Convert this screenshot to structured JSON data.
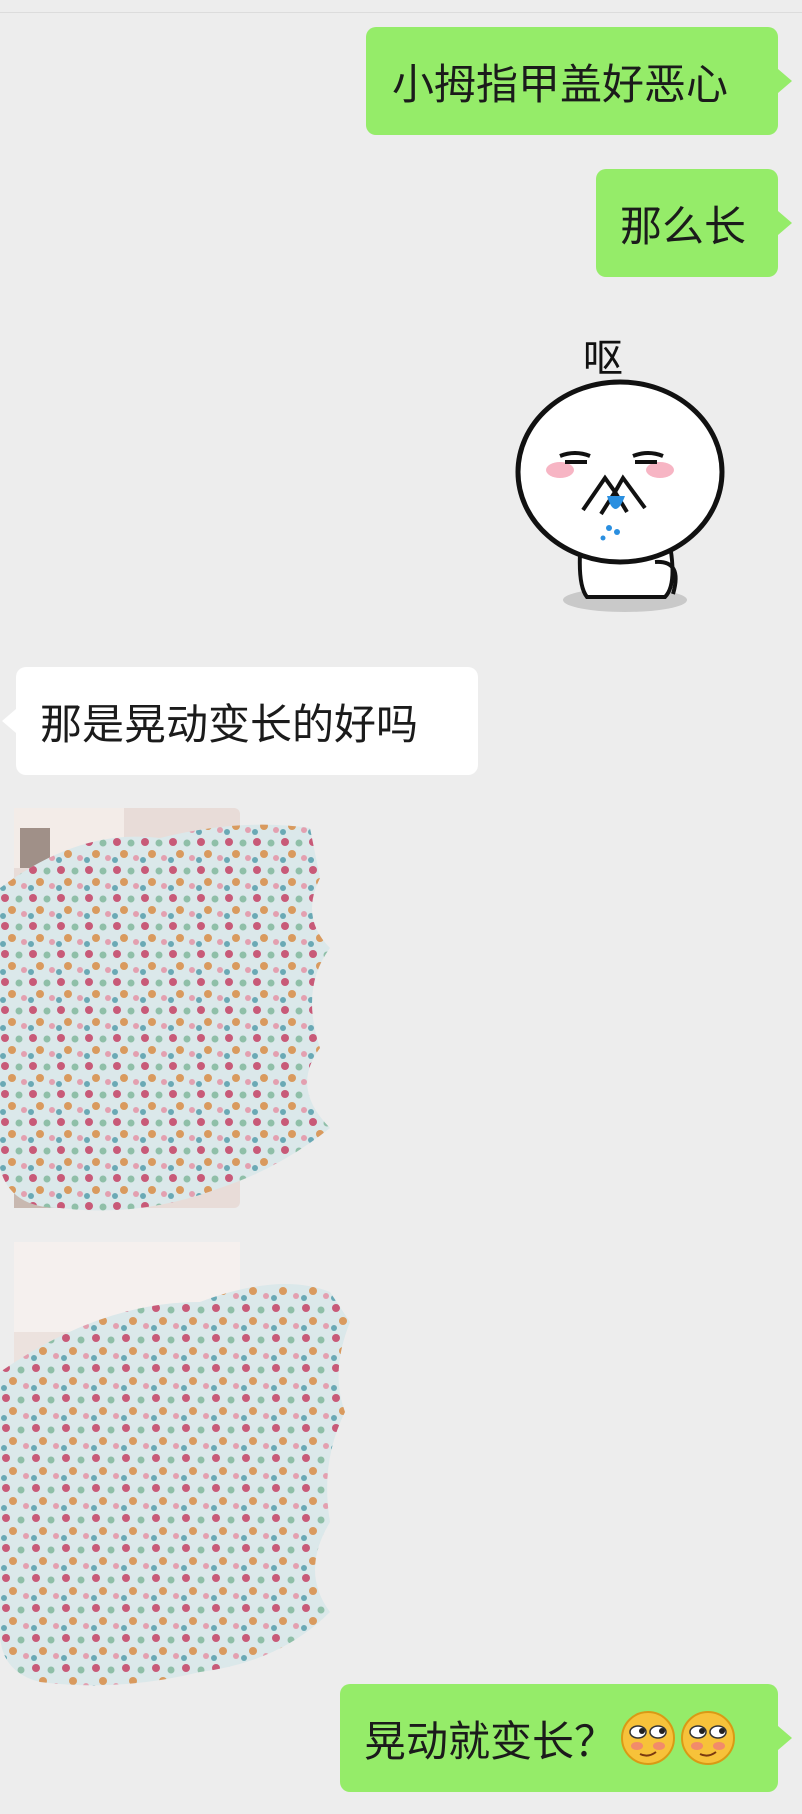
{
  "messages": [
    {
      "side": "me",
      "type": "text",
      "text": "小拇指甲盖好恶心"
    },
    {
      "side": "me",
      "type": "text",
      "text": "那么长"
    },
    {
      "side": "me",
      "type": "sticker",
      "sticker_name": "vomit-sticker",
      "sticker_text": "呕"
    },
    {
      "side": "them",
      "type": "text",
      "text": "那是晃动变长的好吗"
    },
    {
      "side": "them",
      "type": "image",
      "redacted": true
    },
    {
      "side": "them",
      "type": "image",
      "redacted": true
    },
    {
      "side": "me",
      "type": "text",
      "text": "晃动就变长？",
      "emojis": [
        "smirk-emoji",
        "smirk-emoji"
      ]
    }
  ],
  "colors": {
    "background": "#ededed",
    "outgoing_bubble": "#95ec69",
    "incoming_bubble": "#ffffff",
    "redaction_base": "#dbe8ea"
  }
}
